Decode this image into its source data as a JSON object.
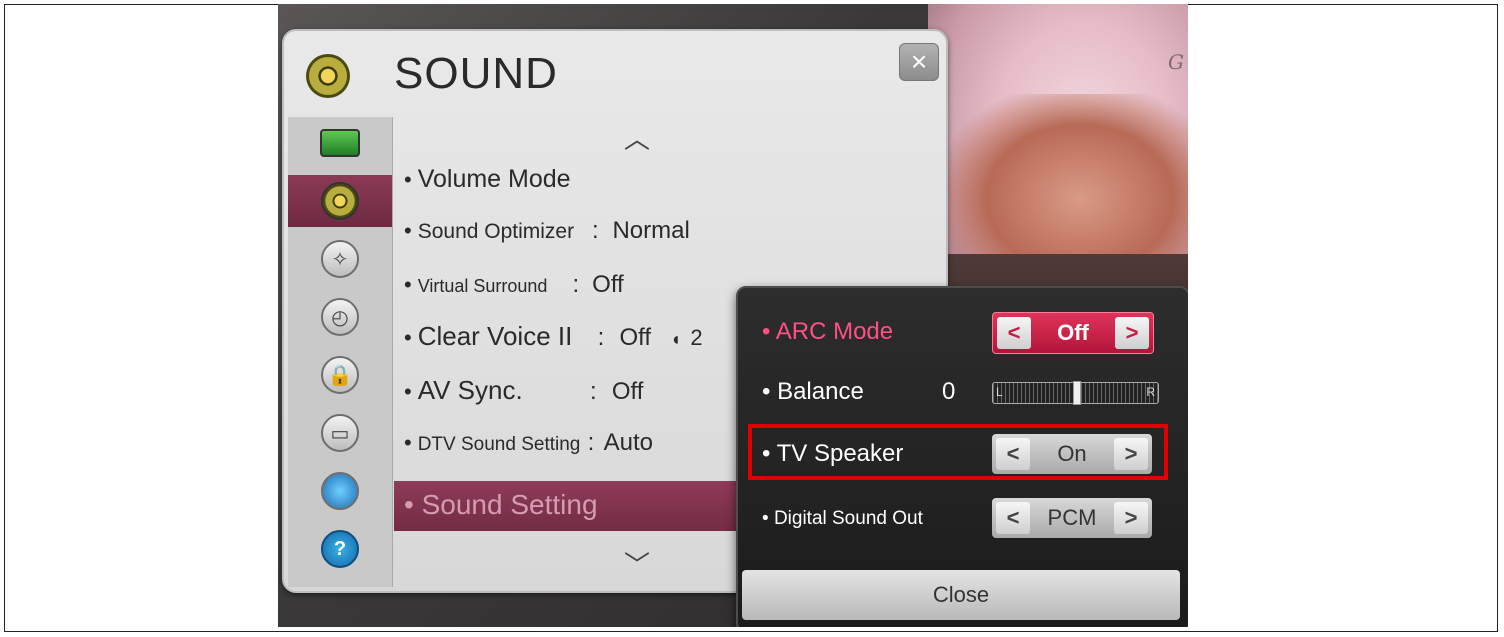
{
  "menu": {
    "title": "SOUND",
    "close_glyph": "×",
    "sidebar_icons": [
      "monitor-icon",
      "speaker-icon",
      "satellite-icon",
      "clock-icon",
      "lock-icon",
      "toolbox-icon",
      "globe-icon",
      "help-icon"
    ],
    "help_glyph": "?",
    "items": [
      {
        "label": "Volume Mode",
        "sep": "",
        "value": ""
      },
      {
        "label": "Sound Optimizer",
        "sep": ":",
        "value": "Normal"
      },
      {
        "label": "Virtual Surround",
        "sep": ":",
        "value": "Off"
      },
      {
        "label": "Clear Voice II",
        "sep": ":",
        "value": "Off",
        "extra": "2"
      },
      {
        "label": "AV Sync.",
        "sep": ":",
        "value": "Off"
      },
      {
        "label": "DTV Sound Setting",
        "sep": ":",
        "value": "Auto"
      },
      {
        "label": "Sound Setting",
        "sep": "",
        "value": ""
      }
    ]
  },
  "sub_panel": {
    "arc_mode": {
      "label": "ARC Mode",
      "value": "Off"
    },
    "balance": {
      "label": "Balance",
      "value": "0",
      "left": "L",
      "right": "R"
    },
    "tv_speaker": {
      "label": "TV Speaker",
      "value": "On"
    },
    "digital_sound_out": {
      "label": "Digital Sound Out",
      "value": "PCM"
    },
    "close_label": "Close"
  },
  "background": {
    "letter": "G"
  },
  "colors": {
    "accent": "#e0345a",
    "selected": "#7e3350",
    "highlight_box": "#e00000"
  }
}
